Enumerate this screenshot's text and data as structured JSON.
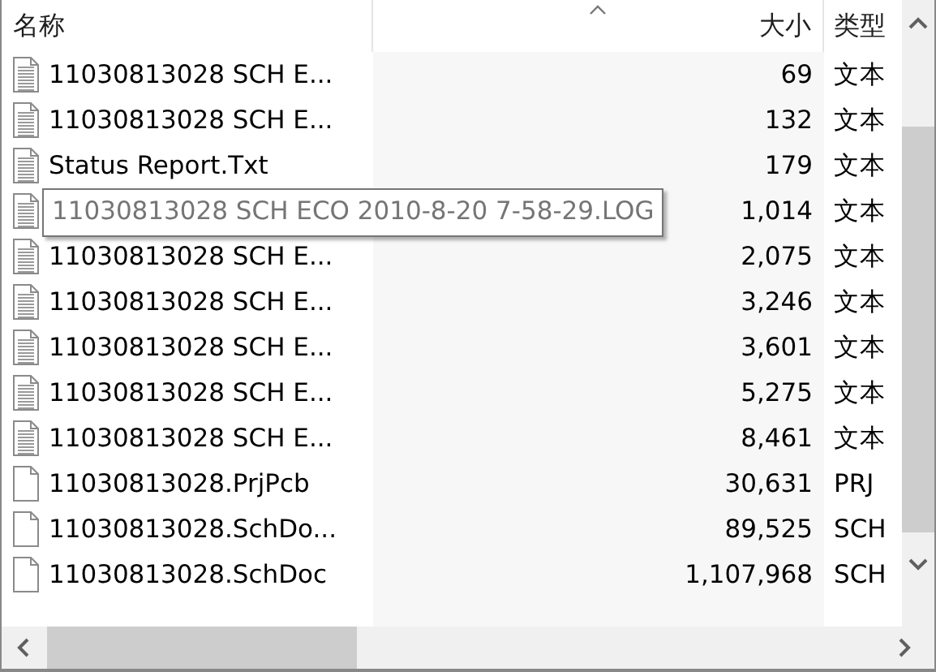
{
  "columns": [
    {
      "label": "名称",
      "sorted": false
    },
    {
      "label": "大小",
      "sorted": true
    },
    {
      "label": "类型",
      "sorted": false
    }
  ],
  "rows": [
    {
      "kind": "text",
      "name": "11030813028 SCH E...",
      "size": "69",
      "type": "文本"
    },
    {
      "kind": "text",
      "name": "11030813028 SCH E...",
      "size": "132",
      "type": "文本"
    },
    {
      "kind": "text",
      "name": "Status Report.Txt",
      "size": "179",
      "type": "文本"
    },
    {
      "kind": "text",
      "tooltip": "11030813028 SCH ECO 2010-8-20 7-58-29.LOG",
      "size": "1,014",
      "type": "文本"
    },
    {
      "kind": "text",
      "name": "11030813028 SCH E...",
      "size": "2,075",
      "type": "文本"
    },
    {
      "kind": "text",
      "name": "11030813028 SCH E...",
      "size": "3,246",
      "type": "文本"
    },
    {
      "kind": "text",
      "name": "11030813028 SCH E...",
      "size": "3,601",
      "type": "文本"
    },
    {
      "kind": "text",
      "name": "11030813028 SCH E...",
      "size": "5,275",
      "type": "文本"
    },
    {
      "kind": "text",
      "name": "11030813028 SCH E...",
      "size": "8,461",
      "type": "文本"
    },
    {
      "kind": "blank",
      "name": "11030813028.PrjPcb",
      "size": "30,631",
      "type": "PRJ"
    },
    {
      "kind": "blank",
      "name": "11030813028.SchDo...",
      "size": "89,525",
      "type": "SCH"
    },
    {
      "kind": "blank",
      "name": "11030813028.SchDoc",
      "size": "1,107,968",
      "type": "SCH"
    }
  ]
}
